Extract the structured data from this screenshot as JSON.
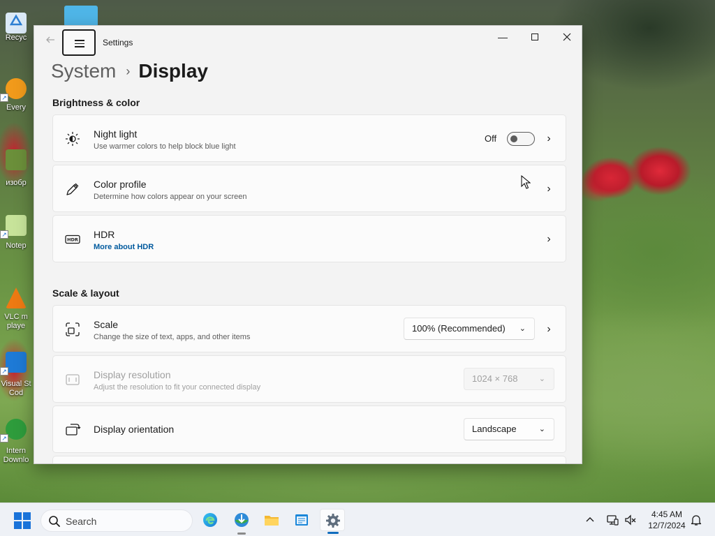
{
  "desktop": {
    "icons": [
      {
        "label": "Recyc"
      },
      {
        "label": "Every"
      },
      {
        "label": "изобр"
      },
      {
        "label": "Notep"
      },
      {
        "label": "VLC m\nplaye"
      },
      {
        "label": "Visual St\nCod"
      },
      {
        "label": "Intern\nDownlo"
      }
    ]
  },
  "window": {
    "app_title": "Settings",
    "breadcrumb": {
      "parent": "System",
      "separator": "›",
      "current": "Display"
    },
    "sections": [
      {
        "title": "Brightness & color",
        "items": [
          {
            "title": "Night light",
            "desc": "Use warmer colors to help block blue light",
            "toggle_label": "Off",
            "toggle_on": false,
            "icon": "brightness-icon"
          },
          {
            "title": "Color profile",
            "desc": "Determine how colors appear on your screen",
            "icon": "pen-icon"
          },
          {
            "title": "HDR",
            "link": "More about HDR",
            "icon": "hdr-icon"
          }
        ]
      },
      {
        "title": "Scale & layout",
        "items": [
          {
            "title": "Scale",
            "desc": "Change the size of text, apps, and other items",
            "value": "100% (Recommended)",
            "icon": "scale-icon"
          },
          {
            "title": "Display resolution",
            "desc": "Adjust the resolution to fit your connected display",
            "value": "1024 × 768",
            "disabled": true,
            "icon": "resolution-icon"
          },
          {
            "title": "Display orientation",
            "value": "Landscape",
            "icon": "orientation-icon"
          }
        ]
      }
    ]
  },
  "taskbar": {
    "search_placeholder": "Search",
    "apps": [
      "edge-icon",
      "internet-download-manager-icon",
      "file-explorer-icon",
      "notepad-icon",
      "settings-icon"
    ],
    "active_app": "settings-icon",
    "clock": {
      "time": "4:45 AM",
      "date": "12/7/2024"
    }
  },
  "colors": {
    "accent": "#0f6cbd",
    "link": "#005a9e",
    "window_bg": "#f3f3f3",
    "card_bg": "#fbfbfb"
  }
}
